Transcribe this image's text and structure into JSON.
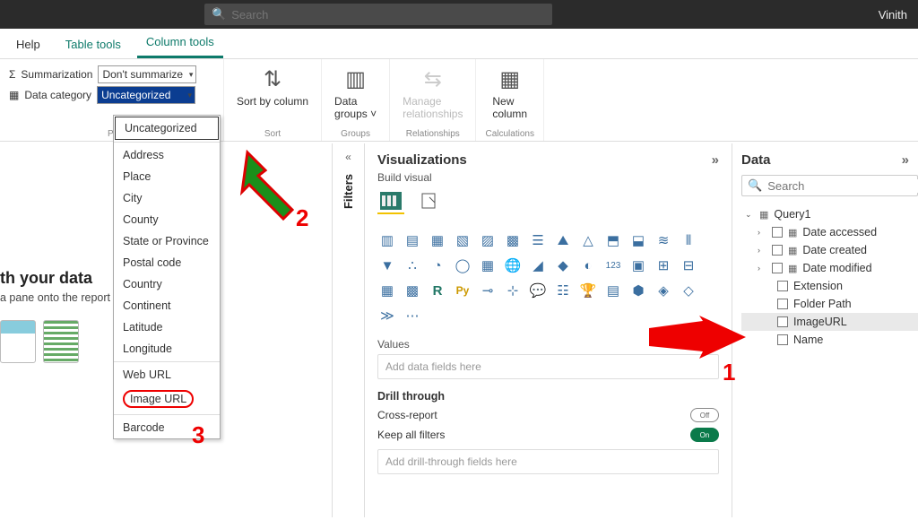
{
  "topbar": {
    "search_placeholder": "Search",
    "user": "Vinith"
  },
  "tabs": {
    "help": "Help",
    "table_tools": "Table tools",
    "column_tools": "Column tools"
  },
  "ribbon": {
    "summarization_label": "Summarization",
    "summarization_value": "Don't summarize",
    "data_category_label": "Data category",
    "data_category_value": "Uncategorized",
    "properties_group": "Properties",
    "sort_by": "Sort by column",
    "sort_group": "Sort",
    "data_groups": "Data groups",
    "groups_group": "Groups",
    "manage_rel": "Manage relationships",
    "rel_group": "Relationships",
    "new_col": "New column",
    "calc_group": "Calculations"
  },
  "dropdown": {
    "items": [
      "Uncategorized",
      "Address",
      "Place",
      "City",
      "County",
      "State or Province",
      "Postal code",
      "Country",
      "Continent",
      "Latitude",
      "Longitude",
      "Web URL",
      "Image URL",
      "Barcode"
    ]
  },
  "canvas": {
    "title": "th your data",
    "subtitle": "a pane onto the report"
  },
  "filters": {
    "label": "Filters"
  },
  "vis": {
    "title": "Visualizations",
    "build": "Build visual",
    "values": "Values",
    "values_ph": "Add data fields here",
    "drill": "Drill through",
    "cross": "Cross-report",
    "keep": "Keep all filters",
    "drill_ph": "Add drill-through fields here",
    "off": "Off",
    "on": "On"
  },
  "data": {
    "title": "Data",
    "search_ph": "Search",
    "query": "Query1",
    "fields": [
      "Date accessed",
      "Date created",
      "Date modified",
      "Extension",
      "Folder Path",
      "ImageURL",
      "Name"
    ]
  },
  "annot": {
    "n1": "1",
    "n2": "2",
    "n3": "3"
  }
}
